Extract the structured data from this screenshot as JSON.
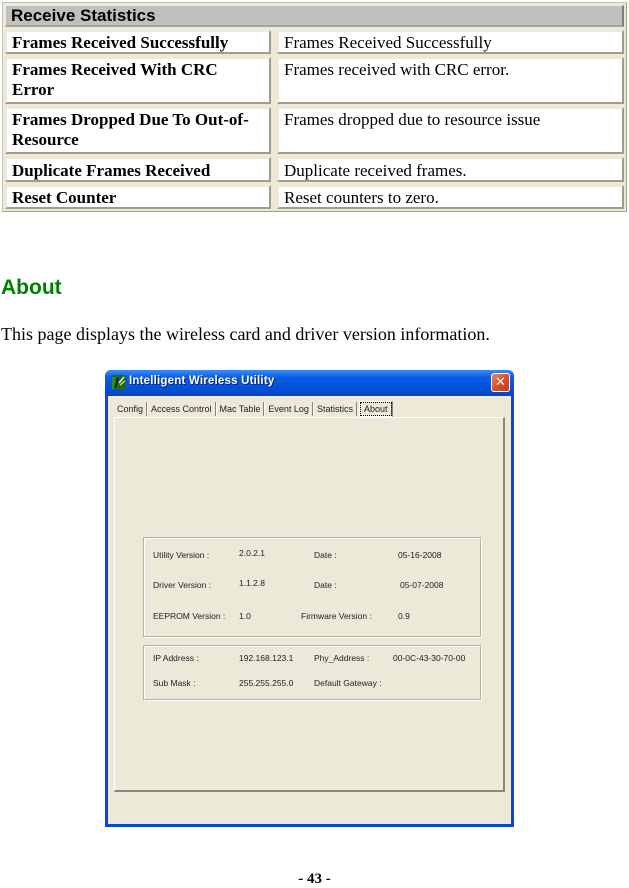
{
  "receive_statistics": {
    "header": "Receive Statistics",
    "rows": [
      {
        "name": "Frames Received Successfully",
        "description": "Frames Received Successfully"
      },
      {
        "name": "Frames Received With CRC Error",
        "description": "Frames received with CRC error."
      },
      {
        "name": "Frames Dropped Due To Out-of-Resource",
        "description": "Frames dropped due to resource issue"
      },
      {
        "name": "Duplicate Frames Received",
        "description": "Duplicate received frames."
      },
      {
        "name": "Reset Counter",
        "description": "Reset counters to zero."
      }
    ]
  },
  "about_section": {
    "heading": "About",
    "description": "This page displays the wireless card and driver version information."
  },
  "window": {
    "title": "Intelligent Wireless Utility",
    "close_icon": "close-icon",
    "app_icon": "wireless-utility-icon",
    "tabs": [
      {
        "label": "Config",
        "active": false
      },
      {
        "label": "Access Control",
        "active": false
      },
      {
        "label": "Mac Table",
        "active": false
      },
      {
        "label": "Event Log",
        "active": false
      },
      {
        "label": "Statistics",
        "active": false
      },
      {
        "label": "About",
        "active": true
      }
    ],
    "version_info": {
      "utility_version_label": "Utility Version :",
      "utility_version": "2.0.2.1",
      "utility_date_label": "Date :",
      "utility_date": "05-16-2008",
      "driver_version_label": "Driver Version :",
      "driver_version": "1.1.2.8",
      "driver_date_label": "Date :",
      "driver_date": "05-07-2008",
      "eeprom_version_label": "EEPROM Version :",
      "eeprom_version": "1.0",
      "firmware_version_label": "Firmware Version :",
      "firmware_version": "0.9"
    },
    "network_info": {
      "ip_address_label": "IP Address :",
      "ip_address": "192.168.123.1",
      "phy_address_label": "Phy_Address :",
      "phy_address": "00-0C-43-30-70-00",
      "sub_mask_label": "Sub Mask :",
      "sub_mask": "255.255.255.0",
      "default_gateway_label": "Default Gateway :",
      "default_gateway": ""
    }
  },
  "page_number": "- 43 -",
  "colors": {
    "heading_green": "#008000",
    "table_header_gray": "#c0c0c0",
    "xp_dialog_face": "#ece9d8",
    "xp_titlebar_blue": "#0a5be6",
    "xp_close_red": "#d5512e"
  }
}
